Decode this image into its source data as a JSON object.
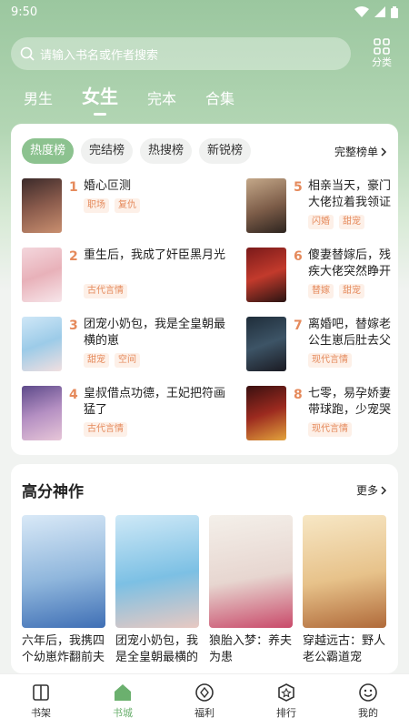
{
  "status": {
    "time": "9:50"
  },
  "search": {
    "placeholder": "请输入书名或作者搜索"
  },
  "category_label": "分类",
  "gender_tabs": [
    {
      "label": "男生"
    },
    {
      "label": "女生"
    },
    {
      "label": "完本"
    },
    {
      "label": "合集"
    }
  ],
  "ranking": {
    "tabs": [
      {
        "label": "热度榜"
      },
      {
        "label": "完结榜"
      },
      {
        "label": "热搜榜"
      },
      {
        "label": "新锐榜"
      }
    ],
    "full_list_label": "完整榜单",
    "items": [
      {
        "rank": "1",
        "title": "婚心叵测",
        "tags": [
          "职场",
          "复仇"
        ]
      },
      {
        "rank": "2",
        "title": "重生后，我成了奸臣黑月光",
        "tags": [
          "古代言情"
        ]
      },
      {
        "rank": "3",
        "title": "团宠小奶包，我是全皇朝最横的崽",
        "tags": [
          "甜宠",
          "空间"
        ]
      },
      {
        "rank": "4",
        "title": "皇叔借点功德，王妃把符画猛了",
        "tags": [
          "古代言情"
        ]
      },
      {
        "rank": "5",
        "title": "相亲当天，豪门大佬拉着我领证",
        "tags": [
          "闪婚",
          "甜宠"
        ]
      },
      {
        "rank": "6",
        "title": "傻妻替嫁后，残疾大佬突然睁开眼",
        "tags": [
          "替嫁",
          "甜宠"
        ]
      },
      {
        "rank": "7",
        "title": "离婚吧，替嫁老公生崽后肚去父留子",
        "tags": [
          "现代言情"
        ]
      },
      {
        "rank": "8",
        "title": "七零，易孕娇妻带球跑，少宠哭了",
        "tags": [
          "现代言情"
        ]
      }
    ]
  },
  "high_quality": {
    "title": "高分神作",
    "more_label": "更多",
    "books": [
      {
        "title": "六年后，我携四个幼崽炸翻前夫家"
      },
      {
        "title": "团宠小奶包，我是全皇朝最横的崽"
      },
      {
        "title": "狼胎入梦：养夫为患"
      },
      {
        "title": "穿越远古：野人老公霸道宠"
      }
    ]
  },
  "bottom_nav": [
    {
      "label": "书架",
      "icon": "bookshelf-icon"
    },
    {
      "label": "书城",
      "icon": "bookstore-icon",
      "active": true
    },
    {
      "label": "福利",
      "icon": "gift-icon"
    },
    {
      "label": "排行",
      "icon": "ranking-icon"
    },
    {
      "label": "我的",
      "icon": "profile-icon"
    }
  ],
  "colors": {
    "accent": "#6bb06e",
    "tab_active": "#8cc28f",
    "rank_number": "#e58a5c",
    "tag_text": "#e58a5c"
  }
}
